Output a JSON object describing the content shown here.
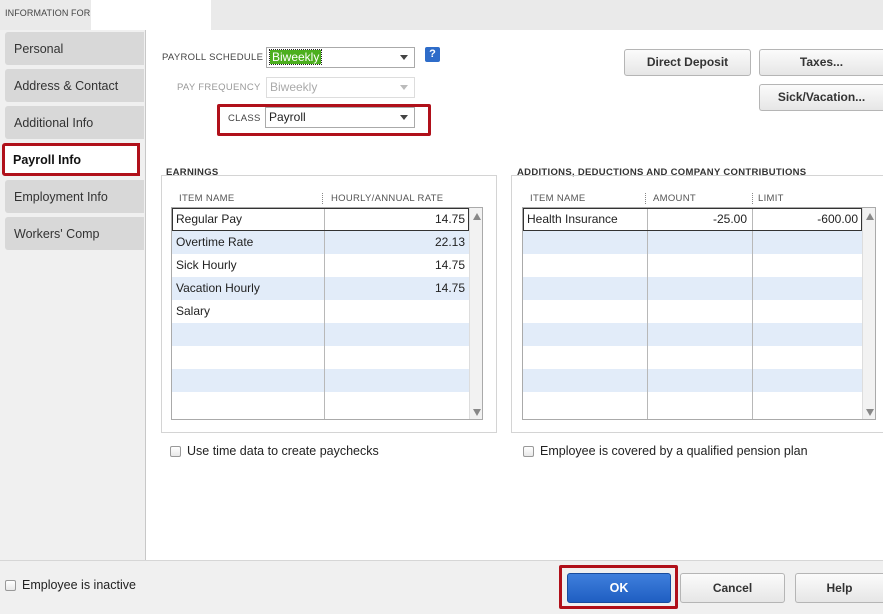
{
  "header": {
    "label": "INFORMATION FOR",
    "name_value": ""
  },
  "sidebar": {
    "tabs": [
      {
        "label": "Personal"
      },
      {
        "label": "Address & Contact"
      },
      {
        "label": "Additional Info"
      },
      {
        "label": "Payroll Info"
      },
      {
        "label": "Employment Info"
      },
      {
        "label": "Workers' Comp"
      }
    ],
    "active": "Payroll Info"
  },
  "form": {
    "payroll_schedule_label": "PAYROLL SCHEDULE",
    "payroll_schedule_value": "Biweekly",
    "pay_frequency_label": "PAY FREQUENCY",
    "pay_frequency_value": "Biweekly",
    "class_label": "CLASS",
    "class_value": "Payroll",
    "help_label": "?"
  },
  "buttons": {
    "direct_deposit": "Direct Deposit",
    "taxes": "Taxes...",
    "sick_vacation": "Sick/Vacation...",
    "ok": "OK",
    "cancel": "Cancel",
    "help": "Help"
  },
  "earnings": {
    "title": "EARNINGS",
    "columns": [
      "ITEM NAME",
      "HOURLY/ANNUAL RATE"
    ],
    "rows": [
      {
        "item": "Regular Pay",
        "rate": "14.75"
      },
      {
        "item": "Overtime Rate",
        "rate": "22.13"
      },
      {
        "item": "Sick Hourly",
        "rate": "14.75"
      },
      {
        "item": "Vacation Hourly",
        "rate": "14.75"
      },
      {
        "item": "Salary",
        "rate": ""
      }
    ]
  },
  "additions": {
    "title": "ADDITIONS, DEDUCTIONS AND COMPANY CONTRIBUTIONS",
    "columns": [
      "ITEM NAME",
      "AMOUNT",
      "LIMIT"
    ],
    "rows": [
      {
        "item": "Health Insurance",
        "amount": "-25.00",
        "limit": "-600.00"
      }
    ]
  },
  "checkboxes": {
    "use_time_data": "Use time data to create paychecks",
    "pension_plan": "Employee is covered by a qualified pension plan",
    "inactive": "Employee is inactive"
  },
  "colors": {
    "accent": "#b0101a",
    "ok_button": "#2b6acb",
    "row_alt": "#e2ecf9"
  }
}
